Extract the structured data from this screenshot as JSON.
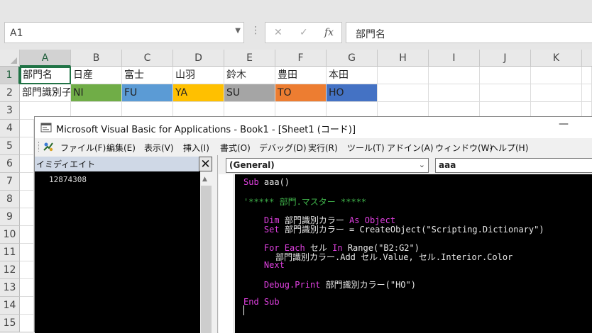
{
  "formula_bar": {
    "name_box": "A1",
    "cancel_icon": "✕",
    "enter_icon": "✓",
    "fx_label": "fx",
    "formula": "部門名"
  },
  "grid": {
    "columns": [
      "A",
      "B",
      "C",
      "D",
      "E",
      "F",
      "G",
      "H",
      "I",
      "J",
      "K"
    ],
    "rows": [
      "1",
      "2",
      "3",
      "4",
      "5",
      "6",
      "7",
      "8",
      "9",
      "10",
      "11",
      "12",
      "13",
      "14",
      "15"
    ],
    "row1": [
      "部門名",
      "日産",
      "富士",
      "山羽",
      "鈴木",
      "豊田",
      "本田"
    ],
    "row2": [
      "部門識別子",
      "NI",
      "FU",
      "YA",
      "SU",
      "TO",
      "HO"
    ],
    "row2_colors": [
      "#70ad47",
      "#5b9bd5",
      "#ffc000",
      "#a5a5a5",
      "#ed7d31",
      "#4472c4"
    ]
  },
  "vba": {
    "title": "Microsoft Visual Basic for Applications - Book1 - [Sheet1 (コード)]",
    "minimize": "—",
    "menu": [
      "ファイル(F)",
      "編集(E)",
      "表示(V)",
      "挿入(I)",
      "書式(O)",
      "デバッグ(D)",
      "実行(R)",
      "ツール(T)",
      "アドイン(A)",
      "ウィンドウ(W)",
      "ヘルプ(H)"
    ],
    "immediate_title": "イミディエイト",
    "immediate_close": "✕",
    "immediate_output": "12874308",
    "object_combo": "(General)",
    "proc_combo": "aaa",
    "code": {
      "l1_kw": "Sub",
      "l1_rest": " aaa()",
      "l2": "'***** 部門.マスター *****",
      "l3_kw": "Dim",
      "l3_mid": " 部門識別カラー ",
      "l3_kw2": "As Object",
      "l4_kw": "Set",
      "l4_rest": " 部門識別カラー = CreateObject(\"Scripting.Dictionary\")",
      "l5_kw": "For Each",
      "l5_mid": " セル ",
      "l5_kw2": "In",
      "l5_rest": " Range(\"B2:G2\")",
      "l6": "部門識別カラー.Add セル.Value, セル.Interior.Color",
      "l7_kw": "Next",
      "l8_mid": "Debug.",
      "l8_kw": "Print",
      "l8_rest": " 部門識別カラー(\"HO\")",
      "l9_kw": "End Sub"
    }
  }
}
